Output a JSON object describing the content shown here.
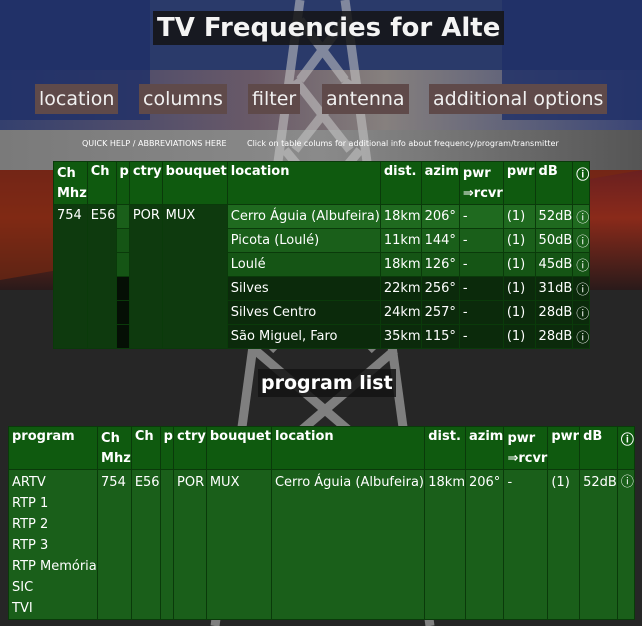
{
  "page": {
    "title": "TV Frequencies for Alte",
    "menu": [
      "location",
      "columns",
      "filter",
      "antenna",
      "additional options"
    ],
    "quick_help": "QUICK HELP / ABBREVIATIONS HERE",
    "click_hint": "Click on table colums for additional info about frequency/program/transmitter",
    "program_list_title": "program list"
  },
  "freq_table": {
    "headers": {
      "ch_mhz_1": "Ch",
      "ch_mhz_2": "Mhz",
      "ch": "Ch",
      "p": "p",
      "ctry": "ctry",
      "bouquet": "bouquet",
      "location": "location",
      "dist": "dist.",
      "azim": "azim",
      "pwr_1": "pwr",
      "pwr_2": "⇒rcvr",
      "pwr2": "pwr",
      "db": "dB",
      "info": "ⓘ"
    },
    "channel": {
      "mhz": "754",
      "ch": "E56",
      "ctry": "POR",
      "bouquet": "MUX"
    },
    "rows": [
      {
        "location": "Cerro Águia (Albufeira)",
        "dist": "18km",
        "azim": "206°",
        "pwr": "-",
        "pwr2": "(1)",
        "db": "52dB",
        "info": "ⓘ"
      },
      {
        "location": "Picota (Loulé)",
        "dist": "11km",
        "azim": "144°",
        "pwr": "-",
        "pwr2": "(1)",
        "db": "50dB",
        "info": "ⓘ"
      },
      {
        "location": "Loulé",
        "dist": "18km",
        "azim": "126°",
        "pwr": "-",
        "pwr2": "(1)",
        "db": "45dB",
        "info": "ⓘ"
      },
      {
        "location": "Silves",
        "dist": "22km",
        "azim": "256°",
        "pwr": "-",
        "pwr2": "(1)",
        "db": "31dB",
        "info": "ⓘ"
      },
      {
        "location": "Silves Centro",
        "dist": "24km",
        "azim": "257°",
        "pwr": "-",
        "pwr2": "(1)",
        "db": "28dB",
        "info": "ⓘ"
      },
      {
        "location": "São Miguel, Faro",
        "dist": "35km",
        "azim": "115°",
        "pwr": "-",
        "pwr2": "(1)",
        "db": "28dB",
        "info": "ⓘ"
      }
    ]
  },
  "program_table": {
    "headers": {
      "program": "program",
      "ch_mhz_1": "Ch",
      "ch_mhz_2": "Mhz",
      "ch": "Ch",
      "p": "p",
      "ctry": "ctry",
      "bouquet": "bouquet",
      "location": "location",
      "dist": "dist.",
      "azim": "azim",
      "pwr_1": "pwr",
      "pwr_2": "⇒rcvr",
      "pwr2": "pwr",
      "db": "dB",
      "info": "ⓘ"
    },
    "programs": [
      "ARTV",
      "RTP 1",
      "RTP 2",
      "RTP 3",
      "RTP Memória",
      "SIC",
      "TVI"
    ],
    "row": {
      "mhz": "754",
      "ch": "E56",
      "p": "",
      "ctry": "POR",
      "bouquet": "MUX",
      "location": "Cerro Águia (Albufeira)",
      "dist": "18km",
      "azim": "206°",
      "pwr": "-",
      "pwr2": "(1)",
      "db": "52dB",
      "info": "ⓘ"
    }
  }
}
